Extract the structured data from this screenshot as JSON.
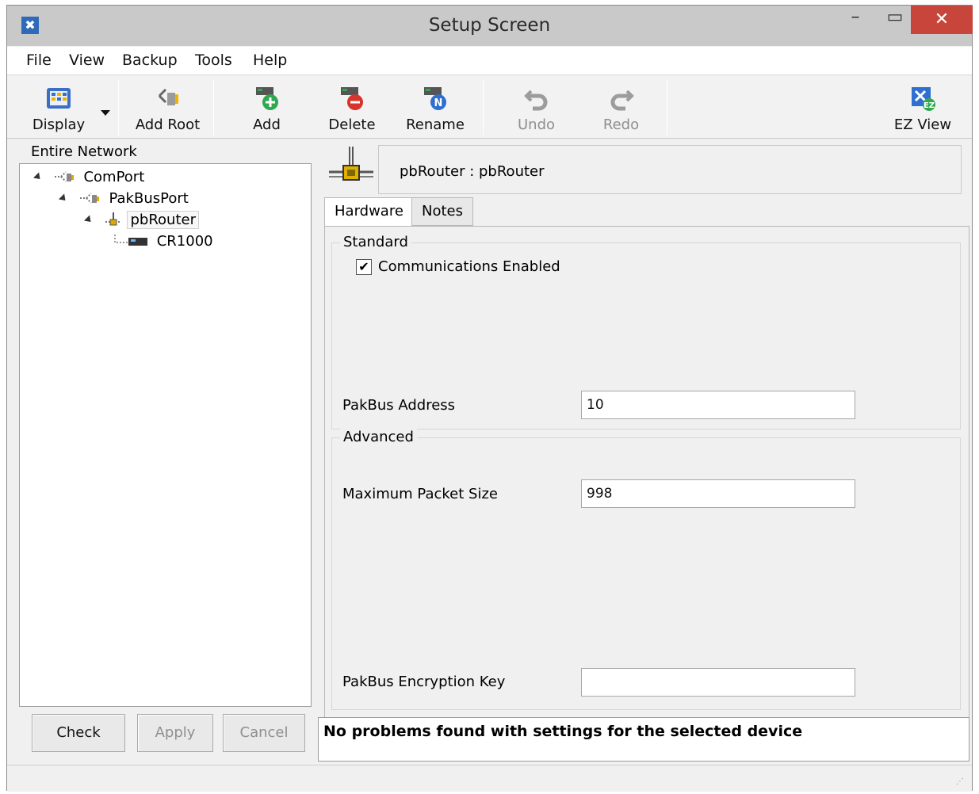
{
  "window": {
    "title": "Setup Screen",
    "minimize": "–",
    "maximize": "▭",
    "close": "✕"
  },
  "menu": [
    "File",
    "View",
    "Backup",
    "Tools",
    "Help"
  ],
  "toolbar": {
    "display": "Display",
    "add_root": "Add Root",
    "add": "Add",
    "delete": "Delete",
    "rename": "Rename",
    "undo": "Undo",
    "redo": "Redo",
    "ez_view": "EZ View"
  },
  "tree": {
    "header": "Entire Network",
    "nodes": [
      "ComPort",
      "PakBusPort",
      "pbRouter",
      "CR1000"
    ]
  },
  "device": {
    "title": "pbRouter : pbRouter"
  },
  "tabs": [
    "Hardware",
    "Notes"
  ],
  "hardware": {
    "standard_group": "Standard",
    "comm_enabled_label": "Communications Enabled",
    "comm_enabled_check": "✔",
    "pakbus_address_label": "PakBus Address",
    "pakbus_address_value": "10",
    "advanced_group": "Advanced",
    "max_packet_label": "Maximum Packet Size",
    "max_packet_value": "998",
    "encryption_label": "PakBus Encryption Key",
    "encryption_value": ""
  },
  "buttons": {
    "check": "Check",
    "apply": "Apply",
    "cancel": "Cancel"
  },
  "status": {
    "message": "No problems found with settings for the selected device"
  }
}
